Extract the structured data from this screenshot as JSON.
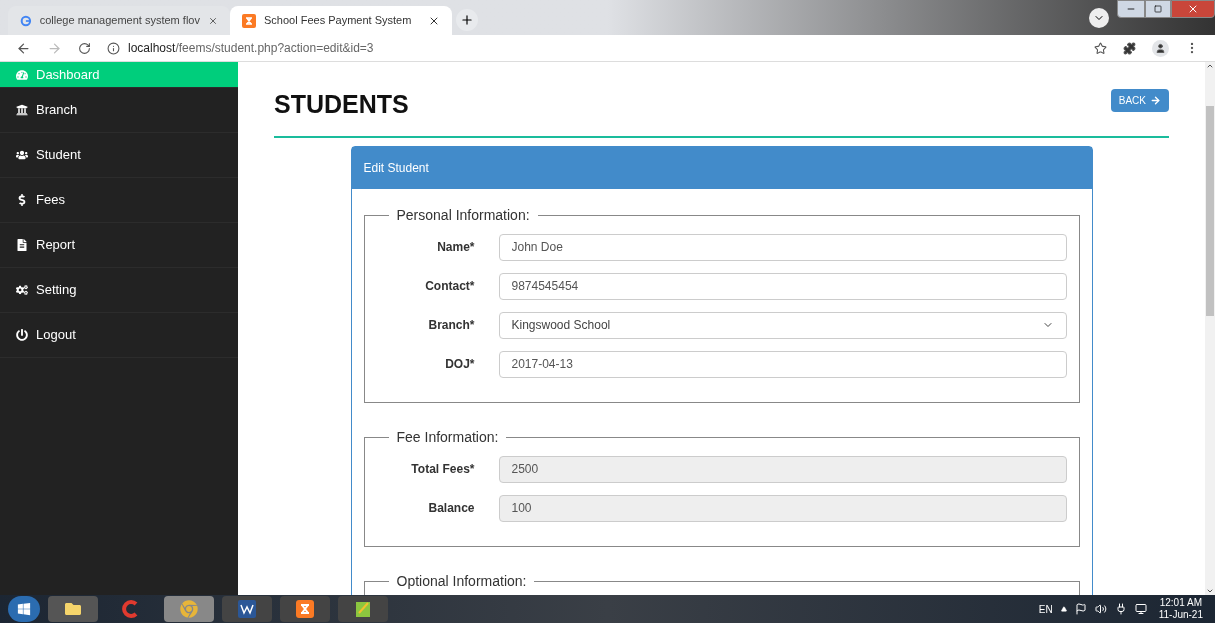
{
  "browser": {
    "tabs": [
      {
        "title": "college management system flov",
        "selected": false
      },
      {
        "title": "School Fees Payment System",
        "selected": true
      }
    ],
    "url_host": "localhost",
    "url_path": "/feems/student.php?action=edit&id=3"
  },
  "sidebar": {
    "items": [
      {
        "label": "Dashboard",
        "selected": true
      },
      {
        "label": "Branch",
        "selected": false
      },
      {
        "label": "Student",
        "selected": false
      },
      {
        "label": "Fees",
        "selected": false
      },
      {
        "label": "Report",
        "selected": false
      },
      {
        "label": "Setting",
        "selected": false
      },
      {
        "label": "Logout",
        "selected": false
      }
    ]
  },
  "page": {
    "title": "STUDENTS",
    "back_button": "BACK"
  },
  "panel": {
    "title": "Edit Student",
    "sections": [
      {
        "legend": "Personal Information:",
        "fields": [
          {
            "label": "Name*",
            "value": "John Doe",
            "kind": "text",
            "disabled": false
          },
          {
            "label": "Contact*",
            "value": "9874545454",
            "kind": "text",
            "disabled": false
          },
          {
            "label": "Branch*",
            "value": "Kingswood School",
            "kind": "select",
            "disabled": false
          },
          {
            "label": "DOJ*",
            "value": "2017-04-13",
            "kind": "text",
            "disabled": false
          }
        ]
      },
      {
        "legend": "Fee Information:",
        "fields": [
          {
            "label": "Total Fees*",
            "value": "2500",
            "kind": "text",
            "disabled": true
          },
          {
            "label": "Balance",
            "value": "100",
            "kind": "text",
            "disabled": true
          }
        ]
      },
      {
        "legend": "Optional Information:"
      }
    ]
  },
  "taskbar": {
    "language": "EN",
    "time": "12:01 AM",
    "date": "11-Jun-21"
  }
}
